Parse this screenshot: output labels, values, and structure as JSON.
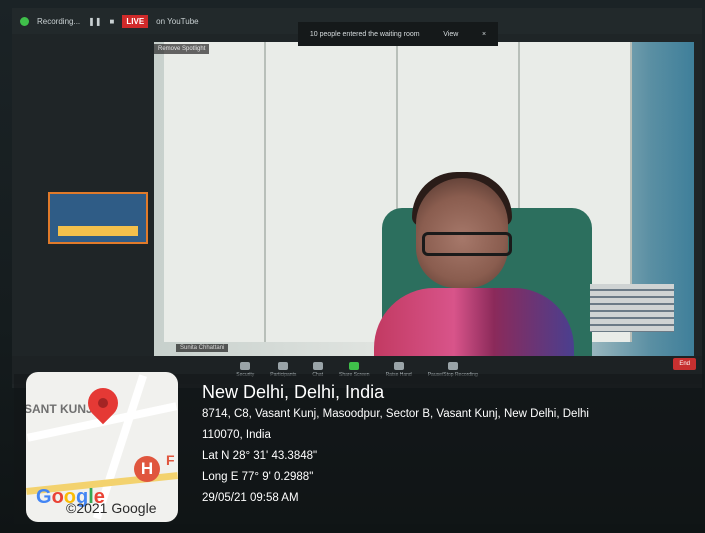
{
  "zoom": {
    "recording_label": "Recording...",
    "live_badge": "LIVE",
    "live_target": "on YouTube",
    "notification_text": "10 people entered the waiting room",
    "notification_view": "View",
    "notification_close": "×",
    "spotlight_label": "Remove Spotlight",
    "speaker_name_tag": "Sunita Chhattani",
    "toolbar_items": [
      "Security",
      "Participants",
      "Chat",
      "Share Screen",
      "Raise Hand",
      "Pause/Stop Recording"
    ],
    "end_button": "End"
  },
  "geotag": {
    "location_title": "New Delhi, Delhi, India",
    "address_line1": "8714, C8, Vasant Kunj, Masoodpur, Sector B, Vasant Kunj, New Delhi, Delhi",
    "address_line2": "110070, India",
    "latitude": "Lat N 28° 31' 43.3848\"",
    "longitude": "Long E 77° 9' 0.2988\"",
    "datetime": "29/05/21 09:58 AM",
    "map_area_label": "SANT KUNJ",
    "map_marker_letter": "H",
    "map_marker_f": "F",
    "map_logo": "Google",
    "map_copyright": "©2021 Google"
  },
  "colors": {
    "live": "#d02a2a",
    "pin": "#e53935",
    "overlay_text": "#ffffff"
  }
}
